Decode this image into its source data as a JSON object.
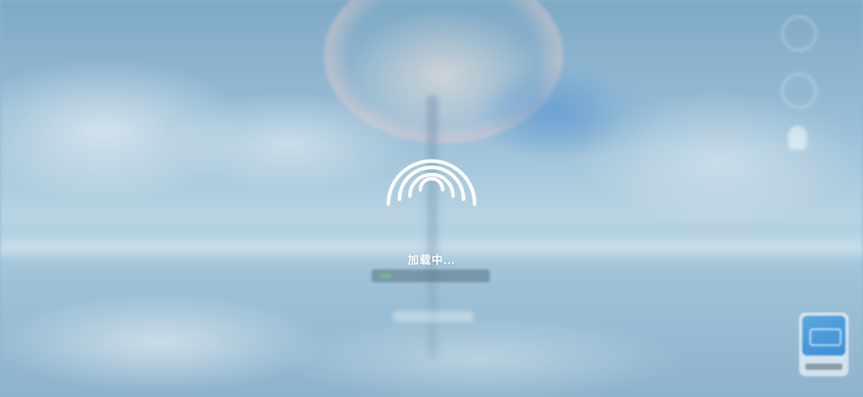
{
  "loading": {
    "text": "加载中...",
    "icon": "signal-arcs-icon"
  },
  "colors": {
    "loader": "#ffffff",
    "background_sky": "#9dc1d8"
  },
  "side_icons": [
    "blurred-top-icon",
    "blurred-middle-icon",
    "blurred-avatar-icon"
  ],
  "corner_app": {
    "icon": "app-shortcut-icon"
  }
}
